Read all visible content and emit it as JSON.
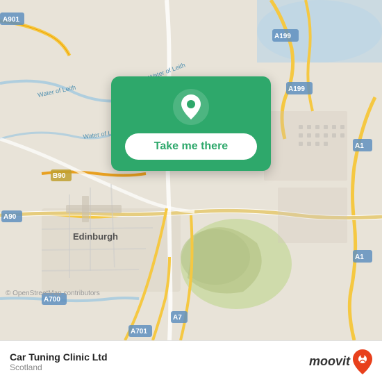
{
  "map": {
    "bg_color": "#e8e3d8",
    "copyright": "© OpenStreetMap contributors"
  },
  "card": {
    "button_label": "Take me there",
    "pin_color": "white",
    "card_color": "#2ea86b"
  },
  "bottom_bar": {
    "title": "Car Tuning Clinic Ltd",
    "subtitle": "Scotland",
    "logo_text": "moovit"
  },
  "road_labels": [
    "A901",
    "A199",
    "A199",
    "A1",
    "A1",
    "B90",
    "A90",
    "A700",
    "A7",
    "A701",
    "Edinburgh"
  ]
}
